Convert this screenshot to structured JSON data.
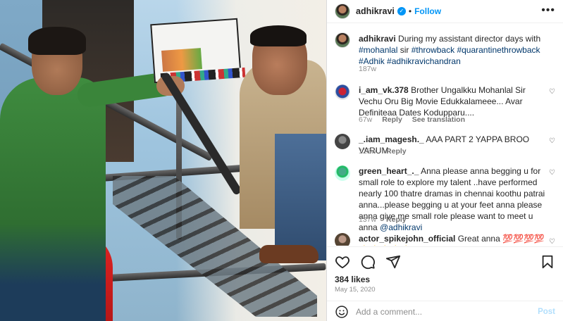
{
  "header": {
    "username": "adhikravi",
    "separator": "•",
    "follow_label": "Follow",
    "more_glyph": "•••"
  },
  "caption": {
    "username": "adhikravi",
    "text_plain": "During my assistant director days with",
    "tag1": "#mohanlal",
    "text_sir": " sir ",
    "tag2": "#throwback",
    "tag3": "#quarantinethrowback",
    "tag4": "#Adhik",
    "tag5": "#adhikravichandran",
    "age": "187w"
  },
  "comments": [
    {
      "username": "i_am_vk.378",
      "text": "Brother Ungalkku Mohanlal Sir Vechu Oru Big Movie Edukkalameee... Avar Definiteaa Dates Kodupparu....",
      "age": "67w",
      "reply": "Reply",
      "extra": "See translation"
    },
    {
      "username": "_.iam_magesh._",
      "text": "AAA PART 2 YAPPA BROO VARUM",
      "age": "128w",
      "reply": "Reply"
    },
    {
      "username": "green_heart_._",
      "text": "Anna please anna begging u for small role to explore my talent ..have performed nearly 100 thatre dramas in chennai koothu patrai anna...please begging u at your feet anna please anna give me small role please want to meet u anna",
      "mention": "@adhikravi",
      "age": "137w",
      "reply": "Reply"
    },
    {
      "username": "actor_spikejohn_official",
      "text": "Great anna 💯💯💯💯💪💪💪💪💪"
    }
  ],
  "actions": {
    "likes": "384 likes",
    "date": "May 15, 2020",
    "comment_placeholder": "Add a comment...",
    "post_label": "Post"
  },
  "colors": {
    "accent": "#0095f6",
    "hashtag": "#00376b",
    "muted": "#8e8e8e"
  },
  "icons": [
    "verified-badge-icon",
    "more-options-icon",
    "heart-icon",
    "comment-icon",
    "share-icon",
    "bookmark-icon",
    "emoji-icon"
  ]
}
